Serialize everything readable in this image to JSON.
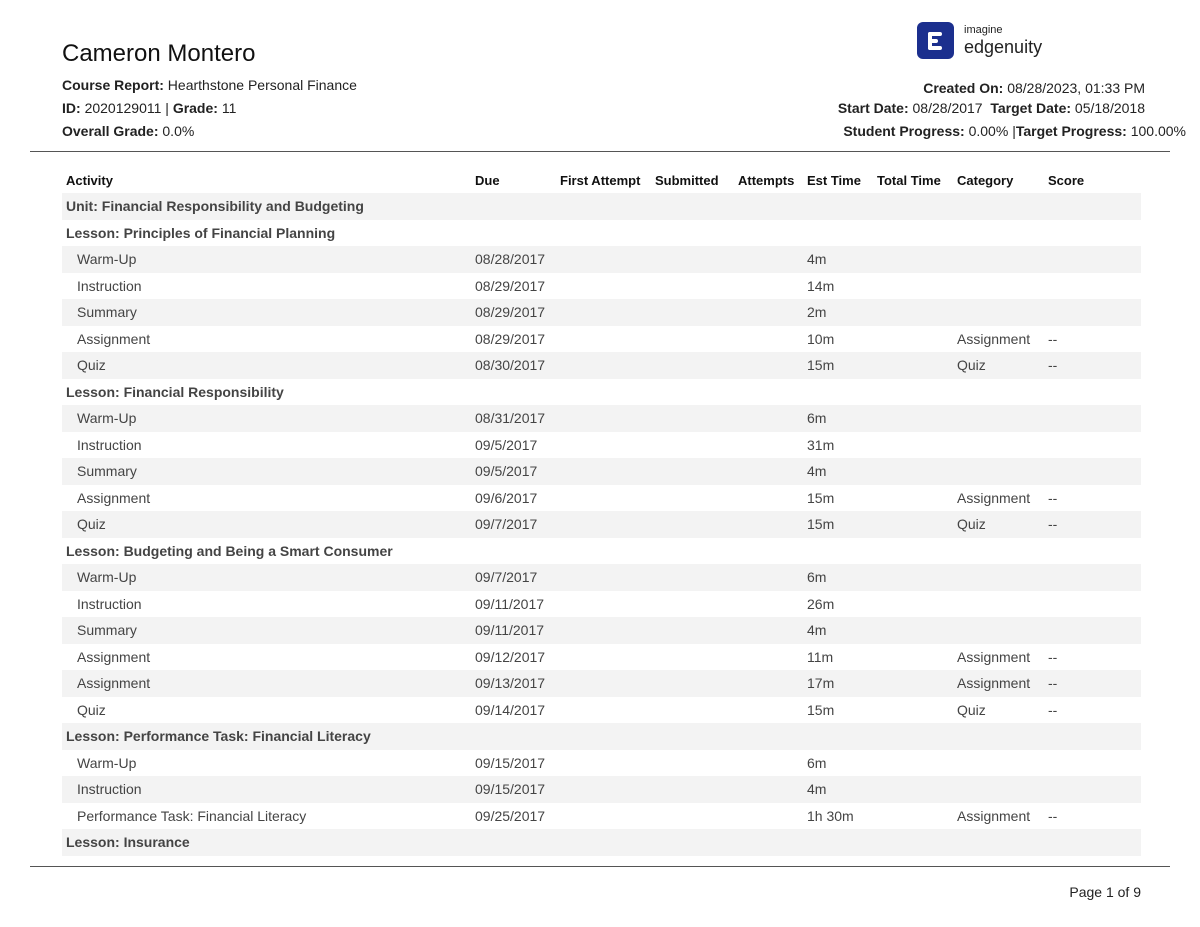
{
  "header": {
    "student_name": "Cameron Montero",
    "course_label": "Course Report:",
    "course_value": "Hearthstone Personal Finance",
    "id_label": "ID:",
    "id_value": "2020129011",
    "separator": "|",
    "grade_label": "Grade:",
    "grade_value": "11",
    "overall_label": "Overall Grade:",
    "overall_value": "0.0%",
    "created_label": "Created On:",
    "created_value": "08/28/2023, 01:33 PM",
    "start_label": "Start Date:",
    "start_value": "08/28/2017",
    "target_date_label": "Target Date:",
    "target_date_value": "05/18/2018",
    "progress_label": "Student Progress:",
    "progress_value": "0.00%",
    "target_progress_label": "Target Progress:",
    "target_progress_value": "100.00%"
  },
  "logo": {
    "small": "imagine",
    "big": "edgenuity",
    "color": "#1b2f8e"
  },
  "table": {
    "columns": [
      "Activity",
      "Due",
      "First Attempt",
      "Submitted",
      "Attempts",
      "Est Time",
      "Total Time",
      "Category",
      "Score"
    ],
    "rows": [
      {
        "activity": "Unit: Financial Responsibility and Budgeting",
        "due": "",
        "first": "",
        "submitted": "",
        "attempts": "",
        "est": "",
        "total": "",
        "category": "",
        "score": ""
      },
      {
        "activity": "Lesson: Principles of Financial Planning",
        "due": "",
        "first": "",
        "submitted": "",
        "attempts": "",
        "est": "",
        "total": "",
        "category": "",
        "score": ""
      },
      {
        "activity": "Warm-Up",
        "due": "08/28/2017",
        "first": "",
        "submitted": "",
        "attempts": "",
        "est": "4m",
        "total": "",
        "category": "",
        "score": ""
      },
      {
        "activity": "Instruction",
        "due": "08/29/2017",
        "first": "",
        "submitted": "",
        "attempts": "",
        "est": "14m",
        "total": "",
        "category": "",
        "score": ""
      },
      {
        "activity": "Summary",
        "due": "08/29/2017",
        "first": "",
        "submitted": "",
        "attempts": "",
        "est": "2m",
        "total": "",
        "category": "",
        "score": ""
      },
      {
        "activity": "Assignment",
        "due": "08/29/2017",
        "first": "",
        "submitted": "",
        "attempts": "",
        "est": "10m",
        "total": "",
        "category": "Assignment",
        "score": "--"
      },
      {
        "activity": "Quiz",
        "due": "08/30/2017",
        "first": "",
        "submitted": "",
        "attempts": "",
        "est": "15m",
        "total": "",
        "category": "Quiz",
        "score": "--"
      },
      {
        "activity": "Lesson: Financial Responsibility",
        "due": "",
        "first": "",
        "submitted": "",
        "attempts": "",
        "est": "",
        "total": "",
        "category": "",
        "score": ""
      },
      {
        "activity": "Warm-Up",
        "due": "08/31/2017",
        "first": "",
        "submitted": "",
        "attempts": "",
        "est": "6m",
        "total": "",
        "category": "",
        "score": ""
      },
      {
        "activity": "Instruction",
        "due": "09/5/2017",
        "first": "",
        "submitted": "",
        "attempts": "",
        "est": "31m",
        "total": "",
        "category": "",
        "score": ""
      },
      {
        "activity": "Summary",
        "due": "09/5/2017",
        "first": "",
        "submitted": "",
        "attempts": "",
        "est": "4m",
        "total": "",
        "category": "",
        "score": ""
      },
      {
        "activity": "Assignment",
        "due": "09/6/2017",
        "first": "",
        "submitted": "",
        "attempts": "",
        "est": "15m",
        "total": "",
        "category": "Assignment",
        "score": "--"
      },
      {
        "activity": "Quiz",
        "due": "09/7/2017",
        "first": "",
        "submitted": "",
        "attempts": "",
        "est": "15m",
        "total": "",
        "category": "Quiz",
        "score": "--"
      },
      {
        "activity": "Lesson: Budgeting and Being a Smart Consumer",
        "due": "",
        "first": "",
        "submitted": "",
        "attempts": "",
        "est": "",
        "total": "",
        "category": "",
        "score": ""
      },
      {
        "activity": "Warm-Up",
        "due": "09/7/2017",
        "first": "",
        "submitted": "",
        "attempts": "",
        "est": "6m",
        "total": "",
        "category": "",
        "score": ""
      },
      {
        "activity": "Instruction",
        "due": "09/11/2017",
        "first": "",
        "submitted": "",
        "attempts": "",
        "est": "26m",
        "total": "",
        "category": "",
        "score": ""
      },
      {
        "activity": "Summary",
        "due": "09/11/2017",
        "first": "",
        "submitted": "",
        "attempts": "",
        "est": "4m",
        "total": "",
        "category": "",
        "score": ""
      },
      {
        "activity": "Assignment",
        "due": "09/12/2017",
        "first": "",
        "submitted": "",
        "attempts": "",
        "est": "11m",
        "total": "",
        "category": "Assignment",
        "score": "--"
      },
      {
        "activity": "Assignment",
        "due": "09/13/2017",
        "first": "",
        "submitted": "",
        "attempts": "",
        "est": "17m",
        "total": "",
        "category": "Assignment",
        "score": "--"
      },
      {
        "activity": "Quiz",
        "due": "09/14/2017",
        "first": "",
        "submitted": "",
        "attempts": "",
        "est": "15m",
        "total": "",
        "category": "Quiz",
        "score": "--"
      },
      {
        "activity": "Lesson: Performance Task: Financial Literacy",
        "due": "",
        "first": "",
        "submitted": "",
        "attempts": "",
        "est": "",
        "total": "",
        "category": "",
        "score": ""
      },
      {
        "activity": "Warm-Up",
        "due": "09/15/2017",
        "first": "",
        "submitted": "",
        "attempts": "",
        "est": "6m",
        "total": "",
        "category": "",
        "score": ""
      },
      {
        "activity": "Instruction",
        "due": "09/15/2017",
        "first": "",
        "submitted": "",
        "attempts": "",
        "est": "4m",
        "total": "",
        "category": "",
        "score": ""
      },
      {
        "activity": "Performance Task: Financial Literacy",
        "due": "09/25/2017",
        "first": "",
        "submitted": "",
        "attempts": "",
        "est": "1h 30m",
        "total": "",
        "category": "Assignment",
        "score": "--"
      },
      {
        "activity": "Lesson: Insurance",
        "due": "",
        "first": "",
        "submitted": "",
        "attempts": "",
        "est": "",
        "total": "",
        "category": "",
        "score": ""
      }
    ]
  },
  "footer": {
    "page": "Page 1 of 9"
  }
}
